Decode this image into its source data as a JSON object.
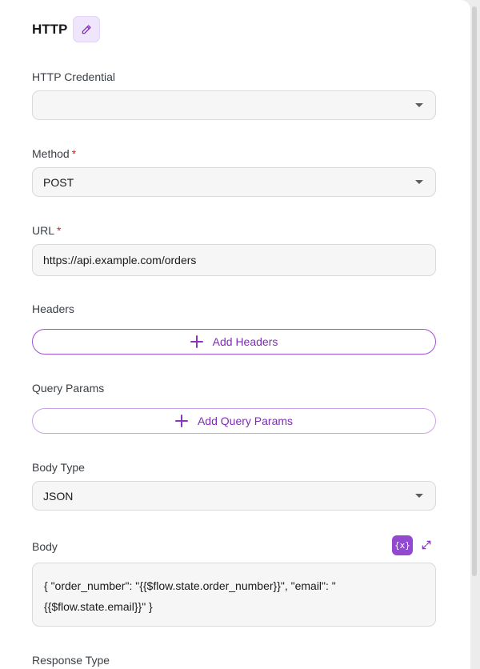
{
  "header": {
    "title": "HTTP",
    "edit_icon": "pencil-icon"
  },
  "credential": {
    "label": "HTTP Credential",
    "value": ""
  },
  "method": {
    "label": "Method",
    "required_mark": "*",
    "value": "POST"
  },
  "url": {
    "label": "URL",
    "required_mark": "*",
    "value": "https://api.example.com/orders"
  },
  "headers": {
    "label": "Headers",
    "button_label": "Add Headers"
  },
  "query_params": {
    "label": "Query Params",
    "button_label": "Add Query Params"
  },
  "body_type": {
    "label": "Body Type",
    "value": "JSON"
  },
  "body": {
    "label": "Body",
    "variable_icon_text": "{x}",
    "value": "{ \"order_number\": \"{{$flow.state.order_number}}\", \"email\": \"{{$flow.state.email}}\" }"
  },
  "response_type": {
    "label": "Response Type"
  },
  "colors": {
    "accent": "#9248d1",
    "required": "#d02424"
  }
}
